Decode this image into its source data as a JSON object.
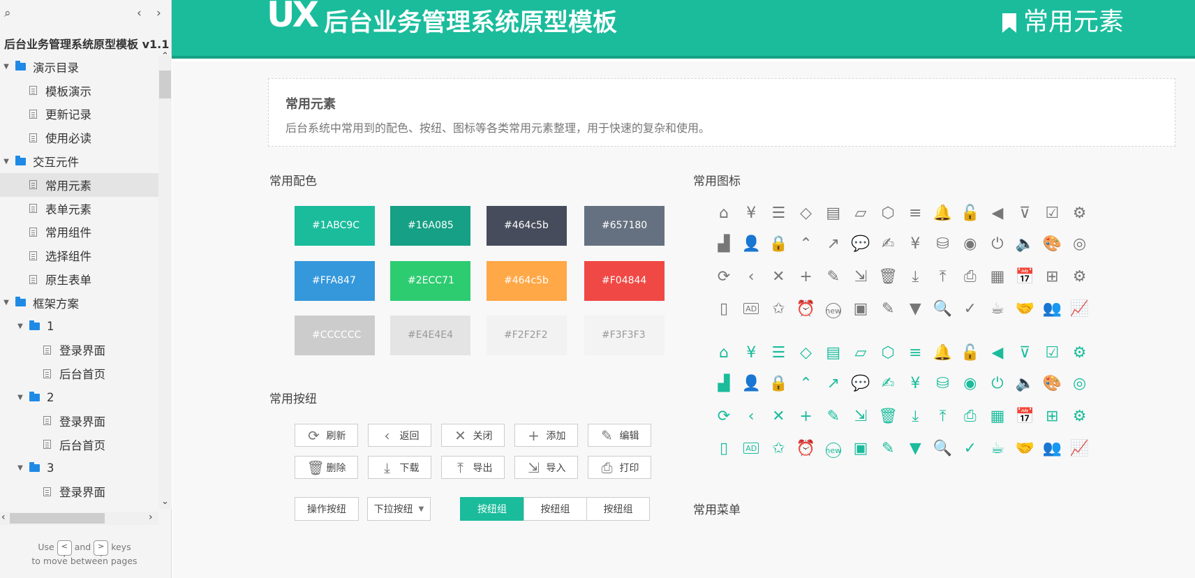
{
  "colors": {
    "accent": "#1abc9c",
    "accent_dark": "#16A085"
  },
  "sidebar": {
    "project_title": "后台业务管理系统原型模板 v1.1",
    "tree": [
      {
        "type": "folder",
        "label": "演示目录",
        "level": 0
      },
      {
        "type": "page",
        "label": "模板演示",
        "level": 1
      },
      {
        "type": "page",
        "label": "更新记录",
        "level": 1
      },
      {
        "type": "page",
        "label": "使用必读",
        "level": 1
      },
      {
        "type": "folder",
        "label": "交互元件",
        "level": 0
      },
      {
        "type": "page",
        "label": "常用元素",
        "level": 1,
        "selected": true
      },
      {
        "type": "page",
        "label": "表单元素",
        "level": 1
      },
      {
        "type": "page",
        "label": "常用组件",
        "level": 1
      },
      {
        "type": "page",
        "label": "选择组件",
        "level": 1
      },
      {
        "type": "page",
        "label": "原生表单",
        "level": 1
      },
      {
        "type": "folder",
        "label": "框架方案",
        "level": 0
      },
      {
        "type": "folder",
        "label": "1",
        "level": 1
      },
      {
        "type": "page",
        "label": "登录界面",
        "level": 2
      },
      {
        "type": "page",
        "label": "后台首页",
        "level": 2
      },
      {
        "type": "folder",
        "label": "2",
        "level": 1
      },
      {
        "type": "page",
        "label": "登录界面",
        "level": 2
      },
      {
        "type": "page",
        "label": "后台首页",
        "level": 2
      },
      {
        "type": "folder",
        "label": "3",
        "level": 1
      },
      {
        "type": "page",
        "label": "登录界面",
        "level": 2
      },
      {
        "type": "page",
        "label": "后台首页",
        "level": 2
      }
    ],
    "hint": {
      "use": "Use",
      "and": "and",
      "keys": "keys",
      "line2": "to move between pages",
      "key_prev": "<\n,",
      "key_next": ">\n."
    }
  },
  "header": {
    "logo": "UX",
    "title": "后台业务管理系统原型模板",
    "right_title": "常用元素"
  },
  "intro": {
    "title": "常用元素",
    "desc": "后台系统中常用到的配色、按纽、图标等各类常用元素整理，用于快速的复杂和使用。"
  },
  "sections": {
    "colors": "常用配色",
    "icons": "常用图标",
    "buttons": "常用按纽",
    "menus": "常用菜单"
  },
  "swatches": [
    {
      "label": "#1ABC9C",
      "bg": "#1ABC9C",
      "fg": "#ffffff"
    },
    {
      "label": "#16A085",
      "bg": "#16A085",
      "fg": "#ffffff"
    },
    {
      "label": "#464c5b",
      "bg": "#464c5b",
      "fg": "#ffffff"
    },
    {
      "label": "#657180",
      "bg": "#657180",
      "fg": "#ffffff"
    },
    {
      "label": "#FFA847",
      "bg": "#3498DB",
      "fg": "#ffffff"
    },
    {
      "label": "#2ECC71",
      "bg": "#2ECC71",
      "fg": "#ffffff"
    },
    {
      "label": "#464c5b",
      "bg": "#FFA847",
      "fg": "#ffffff"
    },
    {
      "label": "#F04844",
      "bg": "#F04844",
      "fg": "#ffffff"
    },
    {
      "label": "#CCCCCC",
      "bg": "#CCCCCC",
      "fg": "#ffffff"
    },
    {
      "label": "#E4E4E4",
      "bg": "#E4E4E4",
      "fg": "#999999"
    },
    {
      "label": "#F2F2F2",
      "bg": "#F2F2F2",
      "fg": "#999999"
    },
    {
      "label": "#F3F3F3",
      "bg": "#F3F3F3",
      "fg": "#999999"
    }
  ],
  "buttons": [
    {
      "label": "刷新",
      "icon": "refresh-icon",
      "glyph": "⟳"
    },
    {
      "label": "返回",
      "icon": "back-icon",
      "glyph": "‹"
    },
    {
      "label": "关闭",
      "icon": "close-icon",
      "glyph": "✕"
    },
    {
      "label": "添加",
      "icon": "add-icon",
      "glyph": "+"
    },
    {
      "label": "编辑",
      "icon": "edit-icon",
      "glyph": "✎"
    },
    {
      "label": "删除",
      "icon": "delete-icon",
      "glyph": "🗑"
    },
    {
      "label": "下载",
      "icon": "download-icon",
      "glyph": "⤓"
    },
    {
      "label": "导出",
      "icon": "export-icon",
      "glyph": "⤒"
    },
    {
      "label": "导入",
      "icon": "import-icon",
      "glyph": "⇲"
    },
    {
      "label": "打印",
      "icon": "print-icon",
      "glyph": "⎙"
    }
  ],
  "action_button": "操作按纽",
  "dropdown_button": "下拉按纽",
  "button_group": [
    "按纽组",
    "按纽组",
    "按纽组"
  ],
  "icons": [
    {
      "name": "home-icon",
      "glyph": "⌂"
    },
    {
      "name": "coin-hand-icon",
      "glyph": "¥"
    },
    {
      "name": "server-icon",
      "glyph": "☰"
    },
    {
      "name": "tag-icon",
      "glyph": "◇"
    },
    {
      "name": "clipboard-icon",
      "glyph": "▤"
    },
    {
      "name": "card-icon",
      "glyph": "▱"
    },
    {
      "name": "cube-icon",
      "glyph": "⬡"
    },
    {
      "name": "menu-icon",
      "glyph": "≡"
    },
    {
      "name": "bell-icon",
      "glyph": "🔔"
    },
    {
      "name": "unlock-icon",
      "glyph": "🔓"
    },
    {
      "name": "triangle-left-icon",
      "glyph": "◀"
    },
    {
      "name": "filter-icon",
      "glyph": "⊽"
    },
    {
      "name": "clipboard-check-icon",
      "glyph": "☑"
    },
    {
      "name": "gear-icon",
      "glyph": "⚙"
    },
    {
      "name": "bar-chart-icon",
      "glyph": "▟"
    },
    {
      "name": "user-icon",
      "glyph": "👤"
    },
    {
      "name": "lock-icon",
      "glyph": "🔒"
    },
    {
      "name": "chevron-up-circle-icon",
      "glyph": "⌃"
    },
    {
      "name": "trend-icon",
      "glyph": "↗"
    },
    {
      "name": "comment-icon",
      "glyph": "💬"
    },
    {
      "name": "user-edit-icon",
      "glyph": "✍"
    },
    {
      "name": "yen-icon",
      "glyph": "¥"
    },
    {
      "name": "database-icon",
      "glyph": "⛁"
    },
    {
      "name": "user-circle-icon",
      "glyph": "◉"
    },
    {
      "name": "power-icon",
      "glyph": "⏻"
    },
    {
      "name": "volume-icon",
      "glyph": "🔈"
    },
    {
      "name": "palette-icon",
      "glyph": "🎨"
    },
    {
      "name": "user-outline-icon",
      "glyph": "◎"
    },
    {
      "name": "refresh-icon",
      "glyph": "⟳"
    },
    {
      "name": "chevron-left-icon",
      "glyph": "‹"
    },
    {
      "name": "close-icon",
      "glyph": "✕"
    },
    {
      "name": "plus-icon",
      "glyph": "+"
    },
    {
      "name": "edit-icon",
      "glyph": "✎"
    },
    {
      "name": "import-icon",
      "glyph": "⇲"
    },
    {
      "name": "trash-icon",
      "glyph": "🗑"
    },
    {
      "name": "download-icon",
      "glyph": "⤓"
    },
    {
      "name": "upload-icon",
      "glyph": "⤒"
    },
    {
      "name": "printer-icon",
      "glyph": "⎙"
    },
    {
      "name": "grid-icon",
      "glyph": "▦"
    },
    {
      "name": "calendar-icon",
      "glyph": "📅"
    },
    {
      "name": "plus-square-icon",
      "glyph": "⊞"
    },
    {
      "name": "user-settings-icon",
      "glyph": "⚙"
    },
    {
      "name": "mobile-icon",
      "glyph": "▯"
    },
    {
      "name": "ad-icon",
      "glyph": "AD"
    },
    {
      "name": "star-circle-icon",
      "glyph": "✩"
    },
    {
      "name": "alarm-icon",
      "glyph": "⏰"
    },
    {
      "name": "new-icon",
      "glyph": "new"
    },
    {
      "name": "image-icon",
      "glyph": "▣"
    },
    {
      "name": "pencil-square-icon",
      "glyph": "✎"
    },
    {
      "name": "caret-down-icon",
      "glyph": "▼"
    },
    {
      "name": "search-icon",
      "glyph": "🔍"
    },
    {
      "name": "check-circle-icon",
      "glyph": "✓"
    },
    {
      "name": "coffee-icon",
      "glyph": "☕"
    },
    {
      "name": "handshake-icon",
      "glyph": "🤝"
    },
    {
      "name": "users-icon",
      "glyph": "👥"
    },
    {
      "name": "line-chart-icon",
      "glyph": "📈"
    }
  ]
}
